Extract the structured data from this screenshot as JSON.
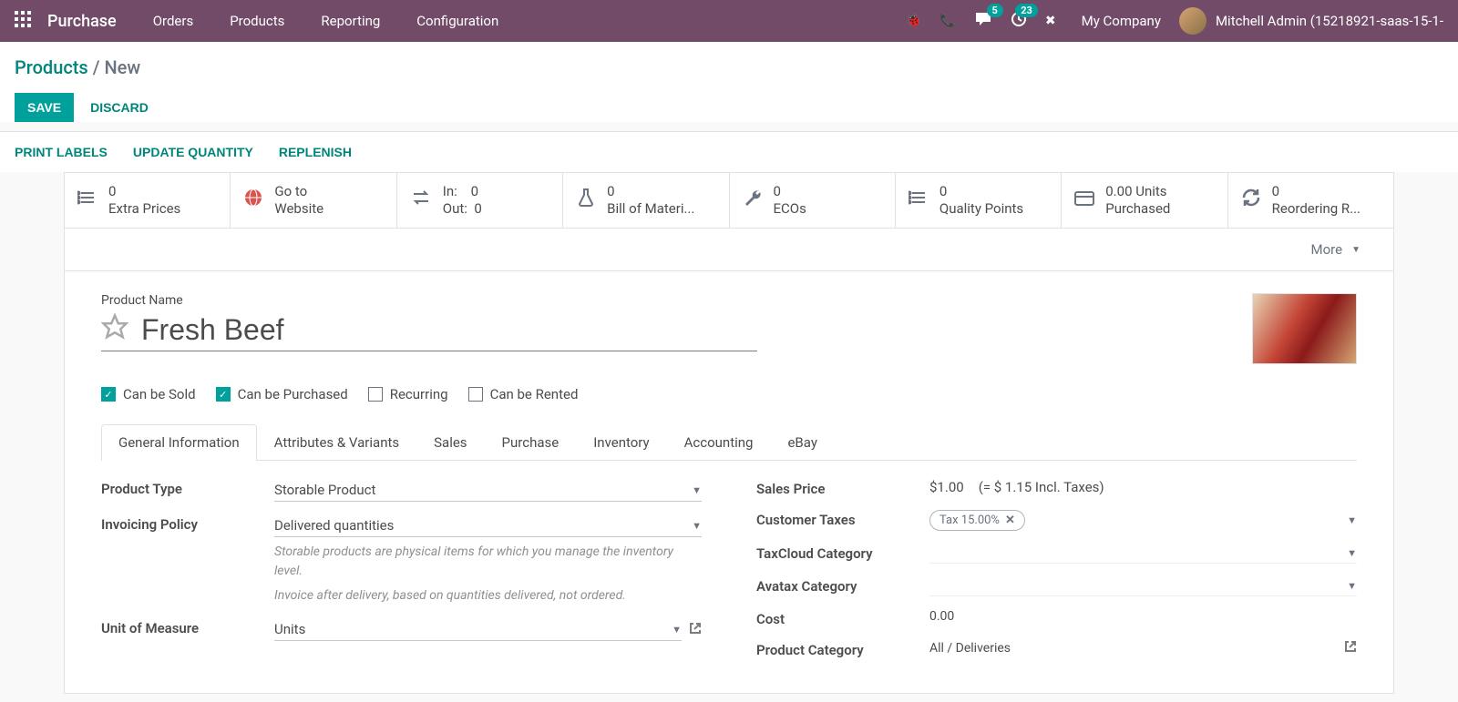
{
  "nav": {
    "brand": "Purchase",
    "items": [
      "Orders",
      "Products",
      "Reporting",
      "Configuration"
    ],
    "msg_badge": "5",
    "act_badge": "23",
    "company": "My Company",
    "user": "Mitchell Admin (15218921-saas-15-1-"
  },
  "breadcrumb": {
    "parent": "Products",
    "current": "New"
  },
  "buttons": {
    "save": "SAVE",
    "discard": "DISCARD"
  },
  "actions": {
    "print": "PRINT LABELS",
    "update": "UPDATE QUANTITY",
    "replenish": "REPLENISH"
  },
  "stats": {
    "extra_prices": {
      "value": "0",
      "label": "Extra Prices"
    },
    "website": {
      "value": "Go to",
      "label": "Website"
    },
    "inout": {
      "in": "In:",
      "in_v": "0",
      "out": "Out:",
      "out_v": "0"
    },
    "bom": {
      "value": "0",
      "label": "Bill of Materi..."
    },
    "ecos": {
      "value": "0",
      "label": "ECOs"
    },
    "quality": {
      "value": "0",
      "label": "Quality Points"
    },
    "purchased": {
      "value": "0.00 Units",
      "label": "Purchased"
    },
    "reorder": {
      "value": "0",
      "label": "Reordering R..."
    },
    "more": "More"
  },
  "product": {
    "name_label": "Product Name",
    "name": "Fresh Beef",
    "can_be_sold": "Can be Sold",
    "can_be_purchased": "Can be Purchased",
    "recurring": "Recurring",
    "can_be_rented": "Can be Rented"
  },
  "tabs": [
    "General Information",
    "Attributes & Variants",
    "Sales",
    "Purchase",
    "Inventory",
    "Accounting",
    "eBay"
  ],
  "left": {
    "product_type": {
      "label": "Product Type",
      "value": "Storable Product"
    },
    "invoicing": {
      "label": "Invoicing Policy",
      "value": "Delivered quantities"
    },
    "help1": "Storable products are physical items for which you manage the inventory level.",
    "help2": "Invoice after delivery, based on quantities delivered, not ordered.",
    "uom": {
      "label": "Unit of Measure",
      "value": "Units"
    }
  },
  "right": {
    "sales_price": {
      "label": "Sales Price",
      "value": "$1.00",
      "incl": "(= $ 1.15 Incl. Taxes)"
    },
    "cust_taxes": {
      "label": "Customer Taxes",
      "tag": "Tax 15.00%"
    },
    "taxcloud": {
      "label": "TaxCloud Category"
    },
    "avatax": {
      "label": "Avatax Category"
    },
    "cost": {
      "label": "Cost",
      "value": "0.00"
    },
    "prod_cat": {
      "label": "Product Category",
      "value": "All / Deliveries"
    }
  }
}
